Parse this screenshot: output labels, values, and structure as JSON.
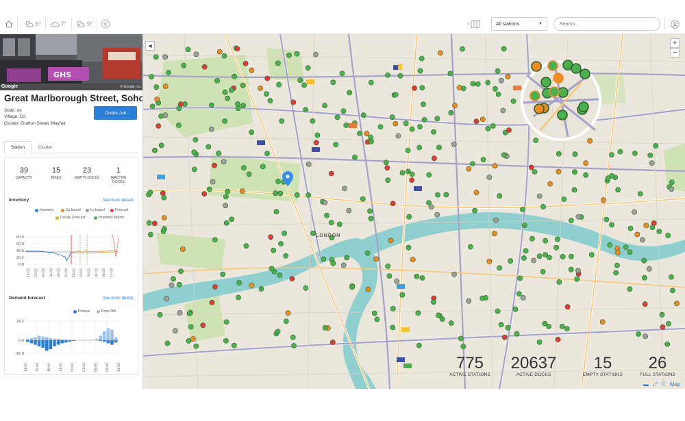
{
  "topbar": {
    "weather": [
      {
        "icon": "cloud-sun-icon",
        "temp": "6°"
      },
      {
        "icon": "cloud-icon",
        "temp": "7°"
      },
      {
        "icon": "cloud-sun-icon",
        "temp": "9°"
      }
    ],
    "station_filter": "All stations",
    "search_placeholder": "Search..."
  },
  "station": {
    "title": "Great Marlborough Street, Soho",
    "state": "State: ok",
    "village": "Village: D2",
    "cluster": "Cluster: Grafton Street, Mayfair",
    "create_job_label": "Create Job",
    "photo_credit_left": "Google",
    "photo_credit_right": "© Google, Inc"
  },
  "tabs": [
    {
      "label": "Station",
      "active": true
    },
    {
      "label": "Cluster",
      "active": false
    }
  ],
  "stats": [
    {
      "value": "39",
      "label": "CAPACITY"
    },
    {
      "value": "15",
      "label": "BIKES"
    },
    {
      "value": "23",
      "label": "EMPTY DOCKS"
    },
    {
      "value": "1",
      "label": "INACTIVE DOCKS"
    }
  ],
  "inventory": {
    "title": "Inventory",
    "link": "See more details",
    "legend": [
      {
        "label": "Inventory",
        "color": "#2c7fd6"
      },
      {
        "label": "Up bound",
        "color": "#f08a24"
      },
      {
        "label": "Lo bound",
        "color": "#999999"
      },
      {
        "label": "Forecast",
        "color": "#e03b3b"
      },
      {
        "label": "Locally Forecast",
        "color": "#c9c22a"
      },
      {
        "label": "Inventory targets",
        "color": "#4caf50"
      }
    ],
    "y_ticks": [
      "80.0",
      "60.0",
      "40.0",
      "20.0",
      "0.0"
    ],
    "x_ticks": [
      "16:00",
      "20:00",
      "00:00",
      "04:00",
      "08:00",
      "12:00",
      "16:00",
      "20:00",
      "00:00",
      "04:00",
      "08:00",
      "12:00"
    ]
  },
  "demand": {
    "title": "Demand forecast",
    "link": "See more details",
    "legend": [
      {
        "label": "Pickups",
        "color": "#2c7fd6"
      },
      {
        "label": "Drop Offs",
        "color": "#9cc3ec"
      }
    ],
    "y_ticks": [
      "24.2",
      "0.0",
      "-16.0"
    ],
    "x_ticks": [
      "12:00",
      "15:00",
      "18:00",
      "21:00",
      "00:00",
      "03:00",
      "06:00",
      "09:00",
      "12:00"
    ]
  },
  "map": {
    "area_label": "LONDON",
    "zoom_in": "+",
    "zoom_out": "−",
    "collapse": "◂",
    "attribution": "Map",
    "stats": [
      {
        "value": "775",
        "label": "ACTIVE STATIONS"
      },
      {
        "value": "20637",
        "label": "ACTIVE DOCKS"
      },
      {
        "value": "15",
        "label": "EMPTY STATIONS"
      },
      {
        "value": "26",
        "label": "FULL STATIONS"
      }
    ]
  },
  "colors": {
    "accent": "#2c7fd6",
    "station_ok": "#4caf50",
    "station_low": "#f08a24",
    "station_empty": "#e03b3b",
    "station_inactive": "#9e9e9e",
    "river": "#8fcfd0",
    "park": "#cfe2b4"
  }
}
